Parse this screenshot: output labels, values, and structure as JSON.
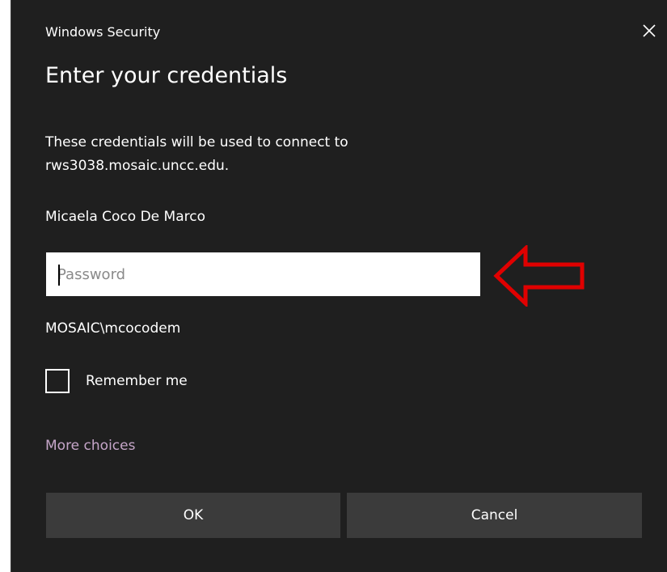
{
  "window": {
    "title": "Windows Security"
  },
  "dialog": {
    "heading": "Enter your credentials",
    "description": "These credentials will be used to connect to rws3038.mosaic.uncc.edu.",
    "username": "Micaela Coco De Marco",
    "password_placeholder": "Password",
    "password_value": "",
    "domain_user": "MOSAIC\\mcocodem",
    "remember_label": "Remember me",
    "remember_checked": false,
    "more_choices_label": "More choices",
    "ok_label": "OK",
    "cancel_label": "Cancel"
  },
  "icons": {
    "close": "close-icon",
    "annotation": "left-arrow-icon"
  },
  "colors": {
    "background": "#1f1f1f",
    "button": "#3b3b3b",
    "link": "#c6a6c9",
    "annotation": "#e00000"
  }
}
